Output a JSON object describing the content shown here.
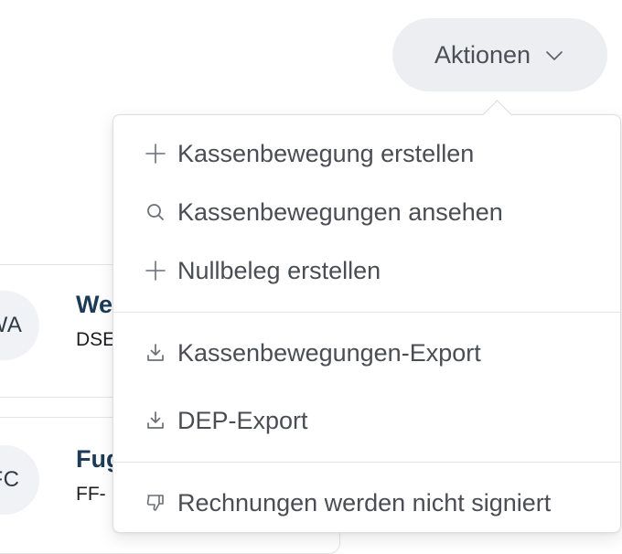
{
  "actions_button": {
    "label": "Aktionen",
    "icon": "chevron-down-icon"
  },
  "menu": {
    "items": [
      {
        "label": "Kassenbewegung erstellen",
        "icon": "plus-icon"
      },
      {
        "label": "Kassenbewegungen ansehen",
        "icon": "search-icon"
      },
      {
        "label": "Nullbeleg erstellen",
        "icon": "plus-icon"
      },
      {
        "label": "Kassenbewegungen-Export",
        "icon": "download-icon"
      },
      {
        "label": "DEP-Export",
        "icon": "download-icon"
      },
      {
        "label": "Rechnungen werden nicht signiert",
        "icon": "thumbs-down-icon"
      }
    ]
  },
  "list": {
    "rows": [
      {
        "initials": "WA",
        "title": "We",
        "subtitle": "DSE"
      },
      {
        "initials": "FC",
        "title": "Fug",
        "subtitle": "FF-"
      }
    ]
  }
}
